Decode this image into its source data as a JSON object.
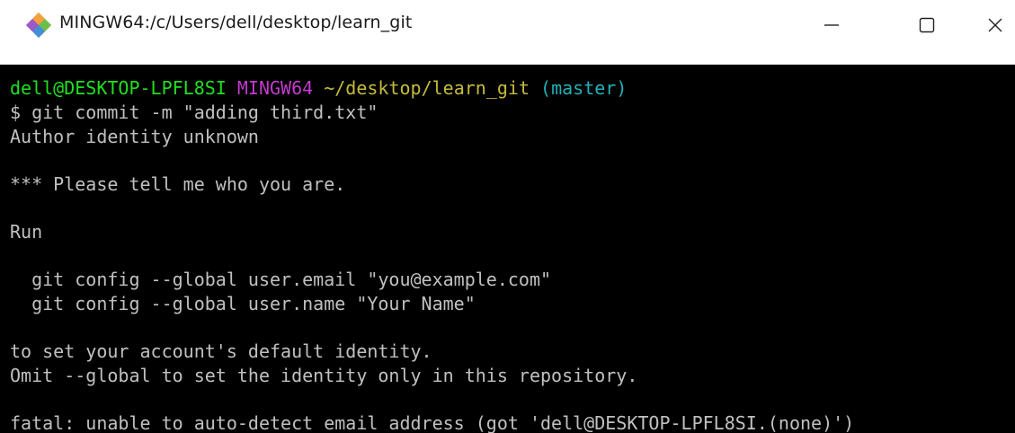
{
  "window": {
    "title": "MINGW64:/c/Users/dell/desktop/learn_git",
    "minimize_glyph": "—",
    "maximize_glyph": "☐",
    "close_glyph": "✕"
  },
  "terminal": {
    "prompt": {
      "user_host": "dell@DESKTOP-LPFL8SI",
      "system": "MINGW64",
      "path": "~/desktop/learn_git",
      "branch": "(master)"
    },
    "command": "$ git commit -m \"adding third.txt\"",
    "output": [
      "Author identity unknown",
      "",
      "*** Please tell me who you are.",
      "",
      "Run",
      "",
      "  git config --global user.email \"you@example.com\"",
      "  git config --global user.name \"Your Name\"",
      "",
      "to set your account's default identity.",
      "Omit --global to set the identity only in this repository.",
      "",
      "fatal: unable to auto-detect email address (got 'dell@DESKTOP-LPFL8SI.(none)')"
    ]
  },
  "colors": {
    "user_host": "#1fe01f",
    "system": "#c23bcd",
    "path": "#c5bb3a",
    "branch": "#23b0b8",
    "text": "#c0c0c0",
    "background": "#000000"
  },
  "icons": {
    "app": "git-bash-diamond-icon",
    "minimize": "minimize-icon",
    "maximize": "maximize-icon",
    "close": "close-icon"
  }
}
